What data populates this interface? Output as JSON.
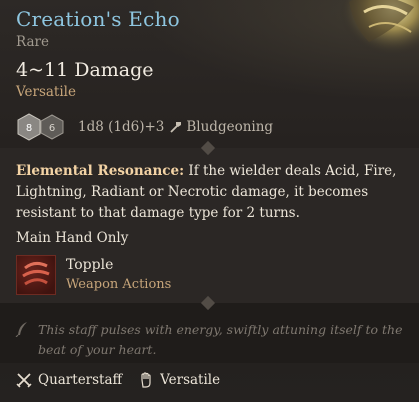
{
  "item": {
    "name": "Creation's Echo",
    "rarity": "Rare",
    "damage": "4~11 Damage",
    "property_tag": "Versatile",
    "dice": [
      "8",
      "6"
    ],
    "roll": "1d8 (1d6)+3",
    "damage_type": "Bludgeoning"
  },
  "resonance": {
    "label": "Elemental Resonance:",
    "text": " If the wielder deals Acid, Fire, Lightning, Radiant or Necrotic damage, it becomes resistant to that damage type for 2 turns."
  },
  "restriction": "Main Hand Only",
  "action": {
    "name": "Topple",
    "category": "Weapon Actions",
    "icon": "topple-icon"
  },
  "flavor": "This staff pulses with energy, swiftly attuning itself to the beat of your heart.",
  "footer": {
    "weapon_type": "Quarterstaff",
    "weapon_icon": "crossed-swords-icon",
    "property": "Versatile",
    "property_icon": "hand-icon"
  },
  "colors": {
    "title": "#8ec6e0",
    "accent": "#c7a57a",
    "resonance_label": "#f3d3a5"
  }
}
